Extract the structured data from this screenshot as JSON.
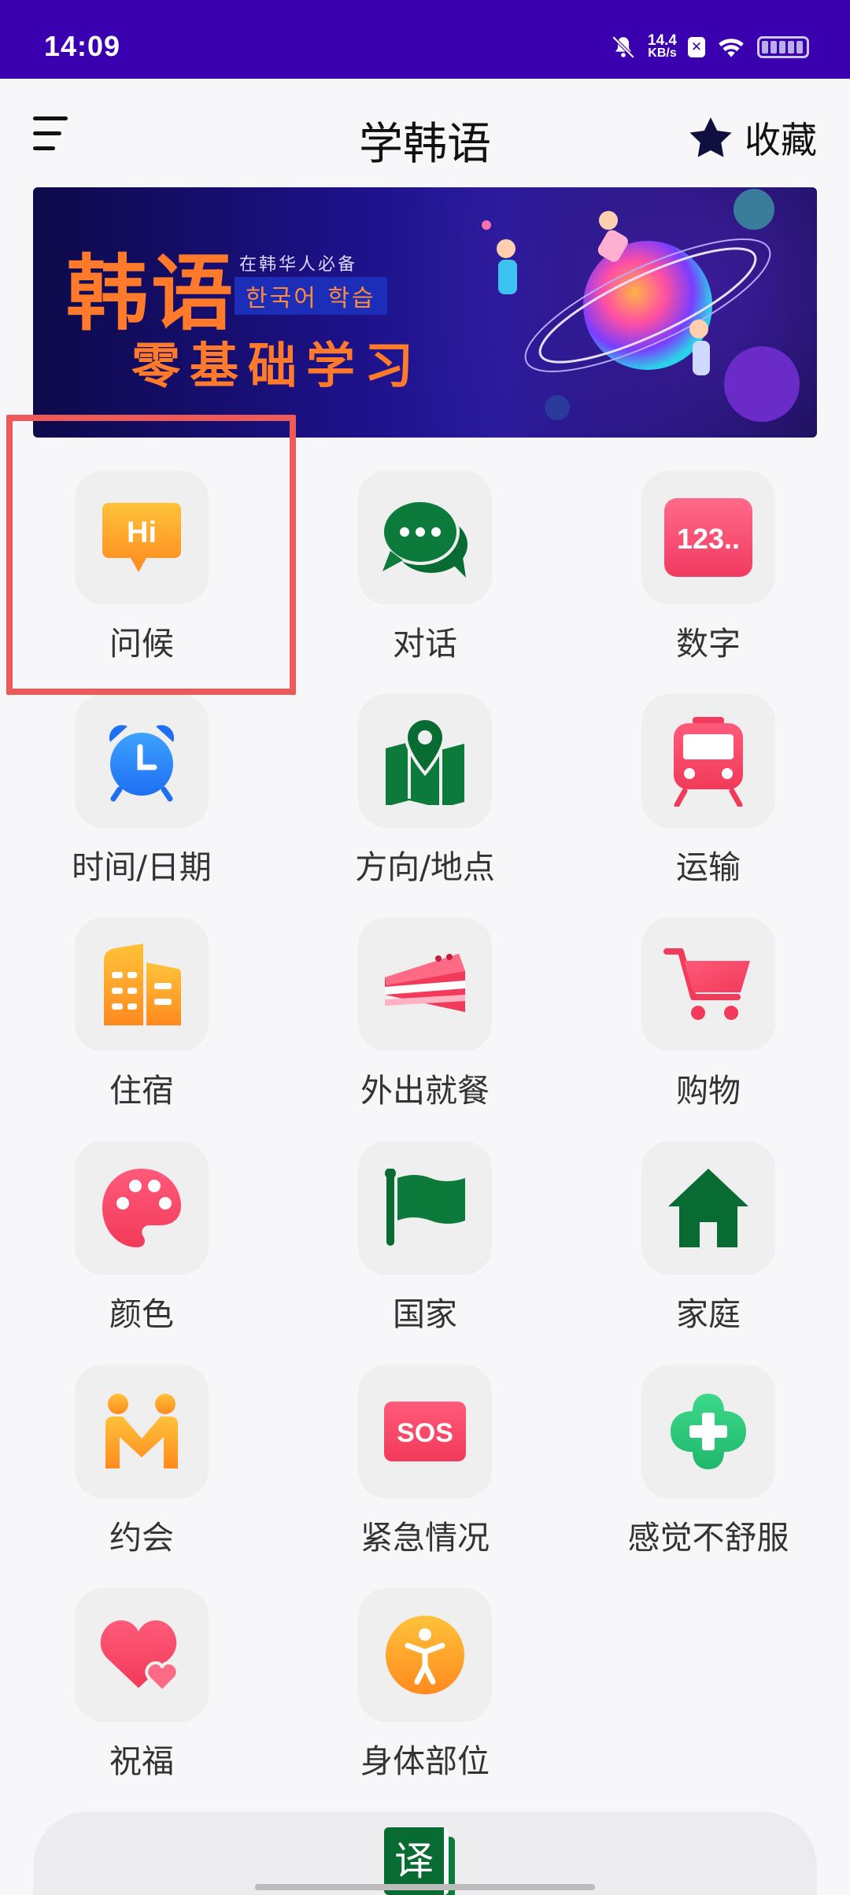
{
  "status_bar": {
    "time": "14:09",
    "net_speed_value": "14.4",
    "net_speed_unit": "KB/s",
    "icons": [
      "mute-bell-icon",
      "x-notification-icon",
      "wifi-icon",
      "battery-icon"
    ]
  },
  "header": {
    "title": "学韩语",
    "favorites_label": "收藏",
    "menu_icon": "hamburger-menu-icon",
    "star_icon": "star-icon"
  },
  "banner": {
    "title": "韩语",
    "subtitle_small": "在韩华人必备",
    "subtitle_korean": "한국어 학습",
    "tagline": "零基础学习"
  },
  "categories": [
    {
      "label": "问候",
      "icon": "hi-chat-bubble-icon"
    },
    {
      "label": "对话",
      "icon": "chat-bubbles-icon"
    },
    {
      "label": "数字",
      "icon": "numbers-123-icon"
    },
    {
      "label": "时间/日期",
      "icon": "alarm-clock-icon"
    },
    {
      "label": "方向/地点",
      "icon": "map-pin-icon"
    },
    {
      "label": "运输",
      "icon": "train-icon"
    },
    {
      "label": "住宿",
      "icon": "buildings-icon"
    },
    {
      "label": "外出就餐",
      "icon": "cake-slice-icon"
    },
    {
      "label": "购物",
      "icon": "shopping-cart-icon"
    },
    {
      "label": "颜色",
      "icon": "palette-icon"
    },
    {
      "label": "国家",
      "icon": "flag-icon"
    },
    {
      "label": "家庭",
      "icon": "house-icon"
    },
    {
      "label": "约会",
      "icon": "couple-icon"
    },
    {
      "label": "紧急情况",
      "icon": "sos-icon"
    },
    {
      "label": "感觉不舒服",
      "icon": "medical-cross-icon"
    },
    {
      "label": "祝福",
      "icon": "hearts-icon"
    },
    {
      "label": "身体部位",
      "icon": "body-figure-icon"
    }
  ],
  "translate": {
    "label": "译",
    "icon": "translate-icon"
  },
  "colors": {
    "status_bar": "#3a00b0",
    "highlight_border": "#ee5a5a",
    "accent_green": "#086b31",
    "accent_pink": "#f5446e",
    "accent_orange": "#ff9c2a"
  }
}
